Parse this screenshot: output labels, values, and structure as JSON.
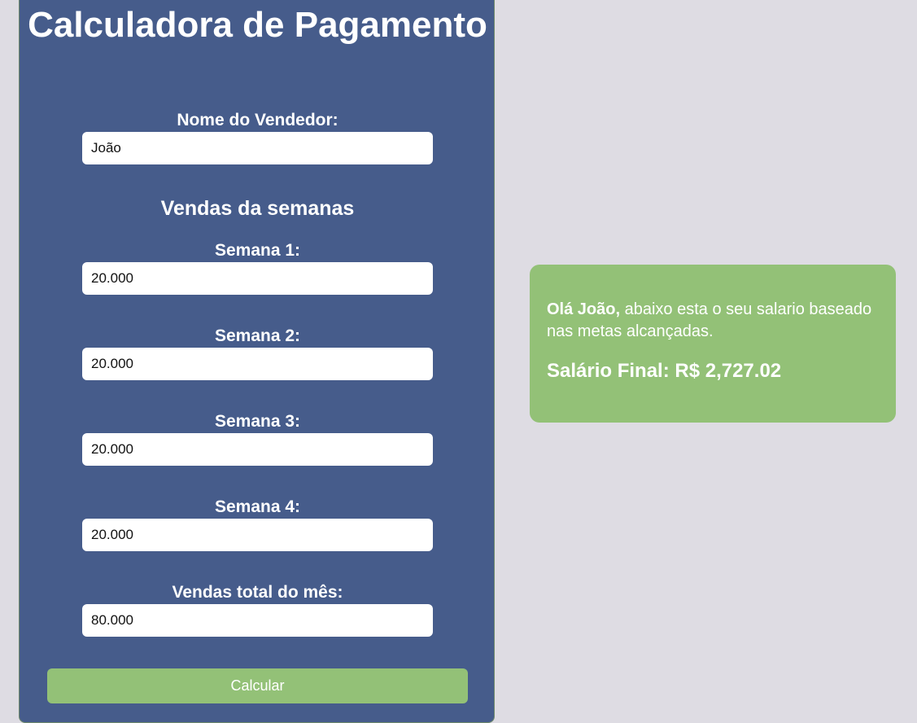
{
  "form": {
    "title": "Calculadora de Pagamento",
    "seller_label": "Nome do Vendedor:",
    "seller_value": "João",
    "weeks_heading": "Vendas da semanas",
    "weeks": [
      {
        "label": "Semana 1:",
        "value": "20.000"
      },
      {
        "label": "Semana 2:",
        "value": "20.000"
      },
      {
        "label": "Semana 3:",
        "value": "20.000"
      },
      {
        "label": "Semana 4:",
        "value": "20.000"
      }
    ],
    "total_label": "Vendas total do mês:",
    "total_value": "80.000",
    "button_label": "Calcular"
  },
  "result": {
    "greeting_name": "Olá João,",
    "greeting_text": " abaixo esta o seu salario baseado nas metas alcançadas.",
    "salary_text": "Salário Final: R$ 2,727.02"
  },
  "colors": {
    "page_bg": "#dedce3",
    "panel_bg": "#465c8b",
    "accent_green": "#93c177",
    "text_white": "#ffffff"
  }
}
